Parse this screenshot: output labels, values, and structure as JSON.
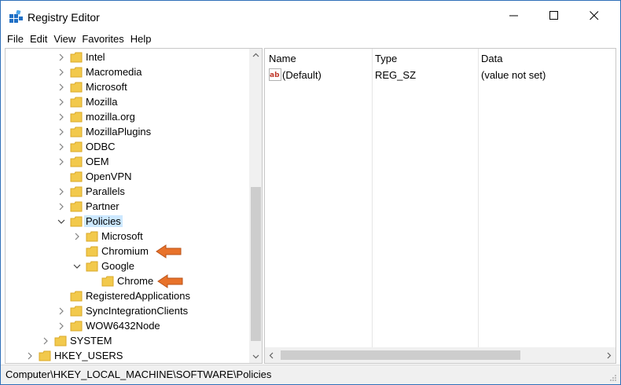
{
  "window": {
    "title": "Registry Editor",
    "minimize_label": "minimize",
    "maximize_label": "maximize",
    "close_label": "close"
  },
  "menu": [
    "File",
    "Edit",
    "View",
    "Favorites",
    "Help"
  ],
  "tree": {
    "items": [
      {
        "label": "Intel",
        "state": "collapsed"
      },
      {
        "label": "Macromedia",
        "state": "collapsed"
      },
      {
        "label": "Microsoft",
        "state": "collapsed"
      },
      {
        "label": "Mozilla",
        "state": "collapsed"
      },
      {
        "label": "mozilla.org",
        "state": "collapsed"
      },
      {
        "label": "MozillaPlugins",
        "state": "collapsed"
      },
      {
        "label": "ODBC",
        "state": "collapsed"
      },
      {
        "label": "OEM",
        "state": "collapsed"
      },
      {
        "label": "OpenVPN",
        "state": "leaf"
      },
      {
        "label": "Parallels",
        "state": "collapsed"
      },
      {
        "label": "Partner",
        "state": "collapsed"
      },
      {
        "label": "Policies",
        "state": "expanded",
        "selected": true
      },
      {
        "label": "Microsoft",
        "state": "collapsed"
      },
      {
        "label": "Chromium",
        "state": "leaf"
      },
      {
        "label": "Google",
        "state": "expanded"
      },
      {
        "label": "Chrome",
        "state": "leaf"
      },
      {
        "label": "RegisteredApplications",
        "state": "leaf"
      },
      {
        "label": "SyncIntegrationClients",
        "state": "collapsed"
      },
      {
        "label": "WOW6432Node",
        "state": "collapsed"
      },
      {
        "label": "SYSTEM",
        "state": "collapsed"
      },
      {
        "label": "HKEY_USERS",
        "state": "collapsed"
      }
    ]
  },
  "list": {
    "columns": [
      "Name",
      "Type",
      "Data"
    ],
    "rows": [
      {
        "name": "(Default)",
        "type": "REG_SZ",
        "data": "(value not set)"
      }
    ]
  },
  "status": {
    "path": "Computer\\HKEY_LOCAL_MACHINE\\SOFTWARE\\Policies"
  },
  "colors": {
    "selection": "#cce8ff",
    "folder": "#f2c94c",
    "pointer": "#e8722a",
    "window_border": "#2f6fb8"
  },
  "icons": {
    "app": "registry-icon",
    "folder": "folder-icon",
    "value": "string-value-icon",
    "pointer": "orange-arrow-icon"
  }
}
